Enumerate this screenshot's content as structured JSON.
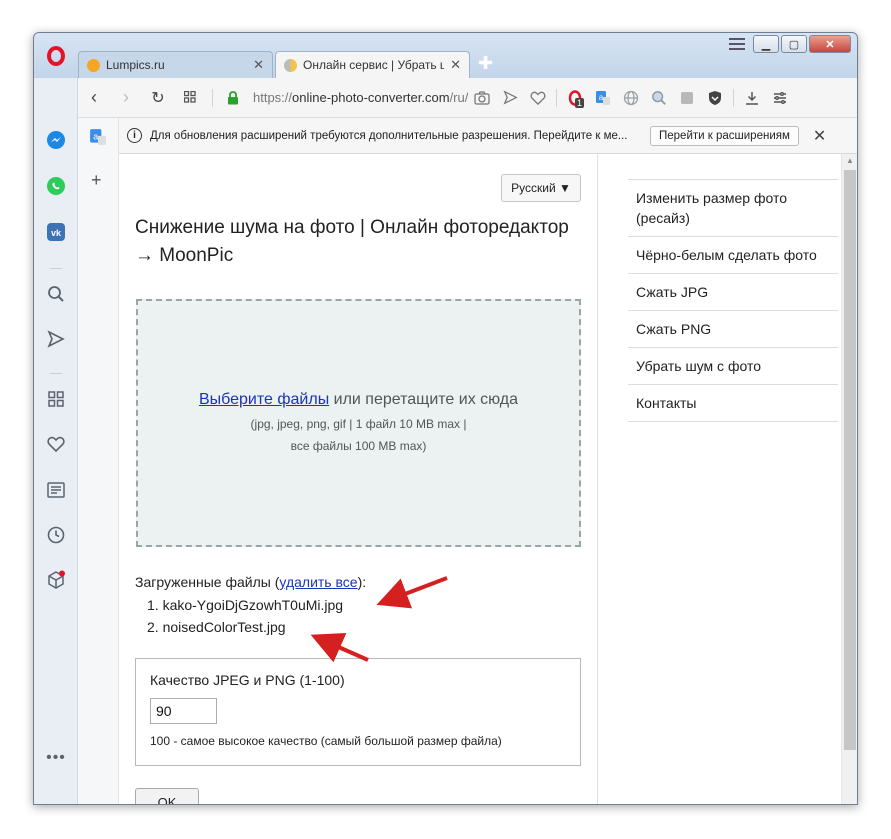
{
  "tabs": [
    {
      "title": "Lumpics.ru",
      "favicon_color": "#f5a623",
      "active": false
    },
    {
      "title": "Онлайн сервис | Убрать шу",
      "favicon_color": "#f3c24a",
      "active": true
    }
  ],
  "toolbar": {
    "url_prefix": "https://",
    "url_host": "online-photo-converter.com",
    "url_path": "/ru/ir",
    "badge_count": "1"
  },
  "infobar": {
    "message": "Для обновления расширений требуются дополнительные разрешения. Перейдите к ме...",
    "button": "Перейти к расширениям",
    "close": "✕"
  },
  "page": {
    "language": "Русский ▼",
    "title": "Снижение шума на фото | Онлайн фоторедактор → MoonPic",
    "dropzone": {
      "link": "Выберите файлы",
      "text": " или перетащите их сюда",
      "formats": "(jpg, jpeg, png, gif | 1 файл 10 MB max |",
      "total": "все файлы 100 MB max)"
    },
    "uploaded_prefix": "Загруженные файлы (",
    "uploaded_link": "удалить все",
    "uploaded_suffix": "):",
    "files": [
      "1.  kako-YgoiDjGzowhT0uMi.jpg",
      "2.  noisedColorTest.jpg"
    ],
    "quality_label": "Качество JPEG и PNG (1-100)",
    "quality_value": "90",
    "quality_hint": "100 - самое высокое качество (самый большой размер файла)",
    "ok_button": "OK"
  },
  "side_menu": [
    "Изменить размер фото (ресайз)",
    "Чёрно-белым сделать фото",
    "Сжать JPG",
    "Сжать PNG",
    "Убрать шум с фото",
    "Контакты"
  ],
  "colors": {
    "link": "#1a33b8",
    "arrow": "#d42020",
    "opera_red": "#e0152b"
  }
}
